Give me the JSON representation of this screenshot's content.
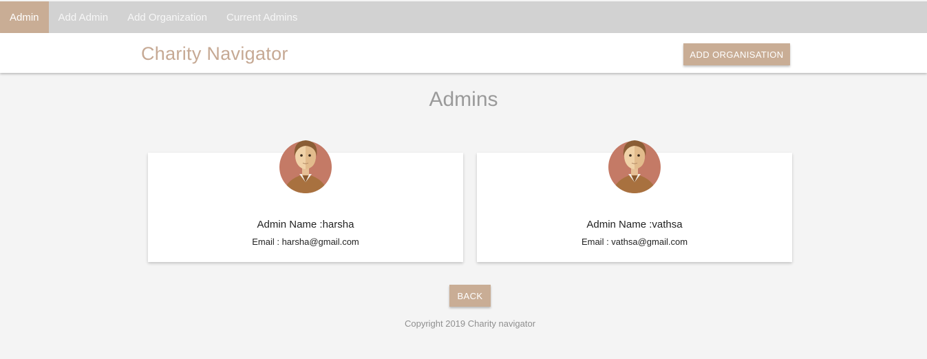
{
  "nav": {
    "items": [
      {
        "label": "Admin",
        "active": true
      },
      {
        "label": "Add Admin",
        "active": false
      },
      {
        "label": "Add Organization",
        "active": false
      },
      {
        "label": "Current Admins",
        "active": false
      }
    ]
  },
  "header": {
    "brand": "Charity Navigator",
    "add_org_label": "ADD ORGANISATION"
  },
  "page": {
    "title": "Admins"
  },
  "admins": [
    {
      "name_line": "Admin Name :harsha",
      "email_line": "Email : harsha@gmail.com",
      "avatar_icon": "male-user-avatar-icon"
    },
    {
      "name_line": "Admin Name :vathsa",
      "email_line": "Email : vathsa@gmail.com",
      "avatar_icon": "male-user-avatar-icon"
    }
  ],
  "actions": {
    "back_label": "BACK"
  },
  "footer": {
    "copyright": "Copyright 2019 Charity navigator"
  },
  "colors": {
    "accent": "#c9ad95",
    "brand_text": "#c6a994",
    "nav_bg": "#d2d2d2",
    "page_bg": "#f4f4f4"
  }
}
